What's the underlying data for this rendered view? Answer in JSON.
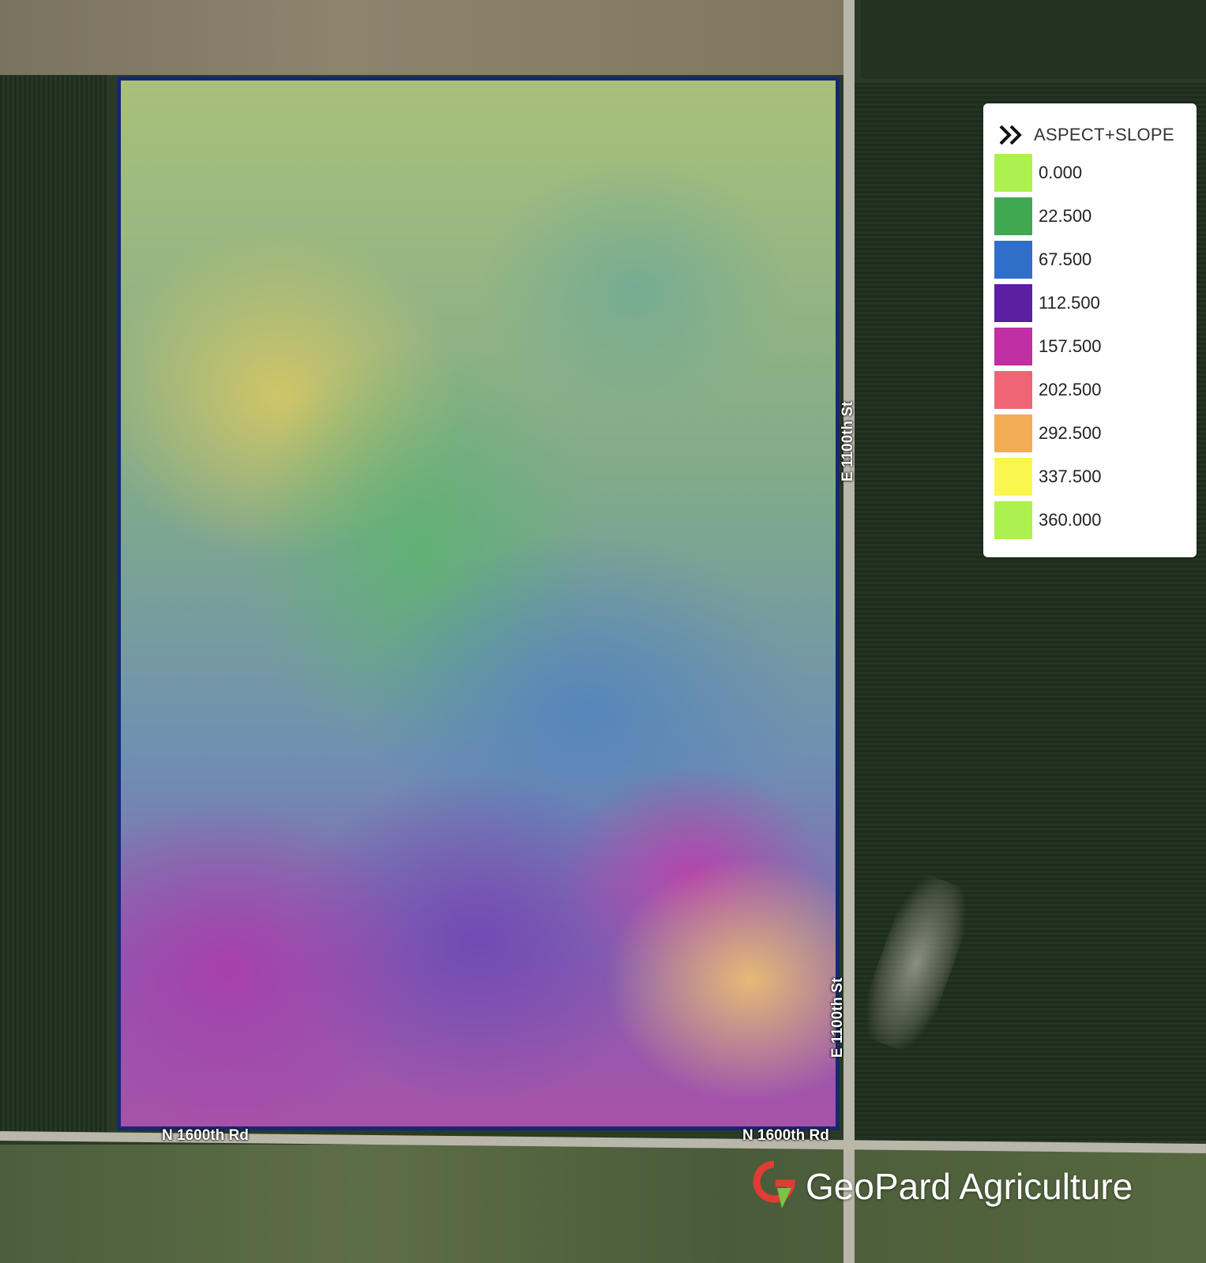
{
  "legend": {
    "title": "ASPECT+SLOPE",
    "items": [
      {
        "value": "0.000",
        "color": "#adf150"
      },
      {
        "value": "22.500",
        "color": "#41a852"
      },
      {
        "value": "67.500",
        "color": "#2f6fc9"
      },
      {
        "value": "112.500",
        "color": "#5a1fa3"
      },
      {
        "value": "157.500",
        "color": "#c02fa4"
      },
      {
        "value": "202.500",
        "color": "#ee6675"
      },
      {
        "value": "292.500",
        "color": "#f4ab55"
      },
      {
        "value": "337.500",
        "color": "#f9f64d"
      },
      {
        "value": "360.000",
        "color": "#adf150"
      }
    ]
  },
  "roads": {
    "east_label": "E 1100th St",
    "north_label": "N 1600th Rd"
  },
  "brand": {
    "name": "GeoPard Agriculture"
  }
}
